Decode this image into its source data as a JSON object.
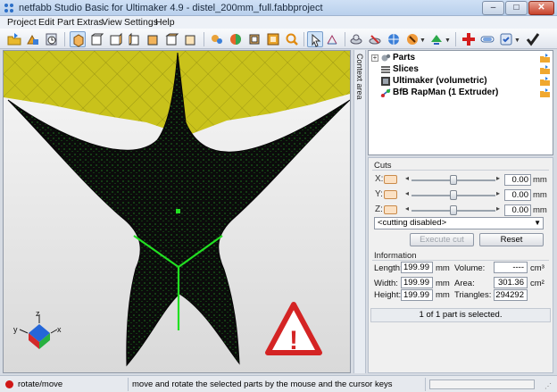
{
  "window": {
    "title": "netfabb Studio Basic for Ultimaker 4.9 - distel_200mm_full.fabbproject",
    "minimize": "–",
    "maximize": "□",
    "close": "✕"
  },
  "menu": [
    "Project",
    "Edit",
    "Part",
    "Extras",
    "View",
    "Settings",
    "Help"
  ],
  "toolbar": {
    "buttons": [
      "open-project-icon",
      "add-part-icon",
      "history-icon",
      "view-3d-icon",
      "view-front-icon",
      "view-back-icon",
      "view-left-icon",
      "view-right-icon",
      "view-top-icon",
      "view-bottom-icon",
      "repair-icon",
      "colors-icon",
      "zoom-fit-icon",
      "zoom-icon",
      "select-arrow-icon",
      "rotate-icon",
      "measure-icon",
      "cut-icon",
      "analysis-icon",
      "support-icon",
      "add-red-cross-icon",
      "toggle-icon",
      "settings-dropdown-icon",
      "apply-check-icon"
    ]
  },
  "viewport": {
    "warning_mark": "!",
    "axes": {
      "x": "x",
      "y": "y",
      "z": "z"
    },
    "colors": {
      "part": "#0b0b0b",
      "mesh_dots": "#2db52d",
      "platform": "#c9c21b",
      "selection": "#22e022",
      "warning": "#d42424"
    }
  },
  "sidetab": {
    "label": "Context area"
  },
  "tree": {
    "items": [
      {
        "label": "Parts",
        "icon": "gears-icon",
        "expandable": true
      },
      {
        "label": "Slices",
        "icon": "slices-icon",
        "expandable": false
      },
      {
        "label": "Ultimaker (volumetric)",
        "icon": "printer-icon",
        "expandable": false
      },
      {
        "label": "BfB RapMan (1 Extruder)",
        "icon": "extruder-icon",
        "expandable": false
      }
    ]
  },
  "cuts": {
    "title": "Cuts",
    "axes": [
      {
        "label": "X:",
        "value": "0.00",
        "unit": "mm"
      },
      {
        "label": "Y:",
        "value": "0.00",
        "unit": "mm"
      },
      {
        "label": "Z:",
        "value": "0.00",
        "unit": "mm"
      }
    ],
    "mode": "<cutting disabled>",
    "execute_label": "Execute cut",
    "reset_label": "Reset"
  },
  "information": {
    "title": "Information",
    "length_label": "Length:",
    "length": "199.99",
    "length_unit": "mm",
    "width_label": "Width:",
    "width": "199.99",
    "width_unit": "mm",
    "height_label": "Height:",
    "height": "199.99",
    "height_unit": "mm",
    "volume_label": "Volume:",
    "volume": "----",
    "volume_unit": "cm³",
    "area_label": "Area:",
    "area": "301.36",
    "area_unit": "cm²",
    "triangles_label": "Triangles:",
    "triangles": "294292",
    "selection_status": "1 of 1 part is selected."
  },
  "statusbar": {
    "mode": "rotate/move",
    "message": "move and rotate the selected parts by the mouse and the cursor keys"
  }
}
